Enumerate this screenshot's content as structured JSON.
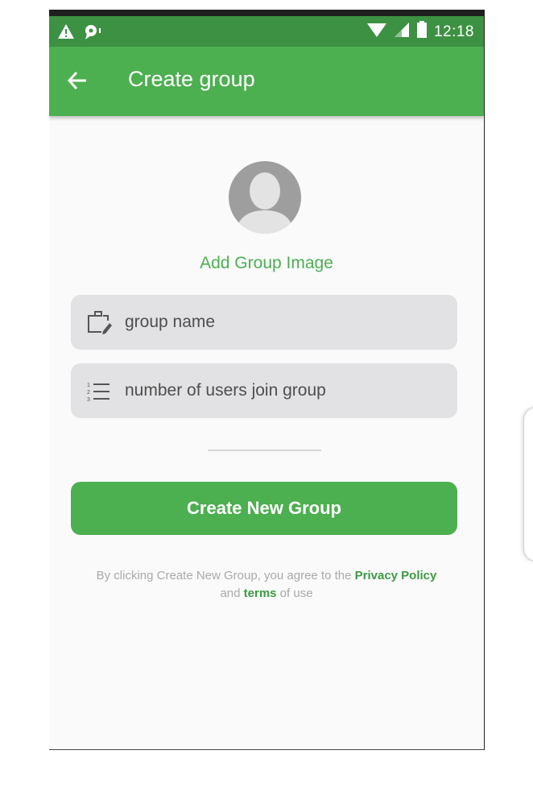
{
  "status_bar": {
    "time": "12:18",
    "left_icons": [
      "warning-icon",
      "notification-icon"
    ],
    "right_icons": [
      "wifi-icon",
      "signal-icon",
      "battery-icon"
    ]
  },
  "app_bar": {
    "title": "Create group",
    "back_icon": "arrow-left-icon"
  },
  "avatar": {
    "add_image_label": "Add Group Image"
  },
  "form": {
    "group_name": {
      "placeholder": "group name",
      "value": "",
      "icon": "briefcase-edit-icon"
    },
    "users_count": {
      "placeholder": "number of users join group",
      "value": "",
      "icon": "numbered-list-icon"
    }
  },
  "create_button": {
    "label": "Create New Group"
  },
  "terms": {
    "prefix": "By clicking Create New Group, you agree to the",
    "privacy_link": "Privacy Policy",
    "and_text": "and",
    "terms_link": "terms",
    "suffix": "of use"
  },
  "colors": {
    "primary": "#4caf50",
    "status_bar": "#3d9142",
    "field_bg": "#e2e2e4",
    "link": "#3c9a43"
  }
}
